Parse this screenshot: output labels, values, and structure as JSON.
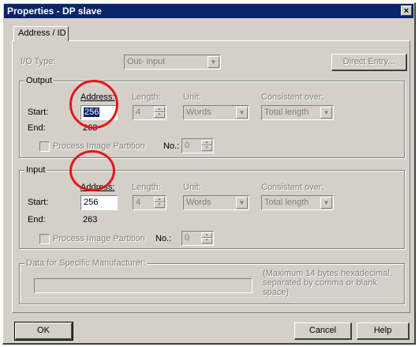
{
  "window": {
    "title": "Properties - DP slave",
    "close_glyph": "×"
  },
  "tab": {
    "label": "Address / ID"
  },
  "io_type": {
    "label": "I/O Type:",
    "value": "Out- input",
    "direct_entry_label": "Direct Entry..."
  },
  "output": {
    "legend": "Output",
    "address_label": "Address:",
    "length_label": "Length:",
    "unit_label": "Unit:",
    "consistent_label": "Consistent over:",
    "start_label": "Start:",
    "end_label": "End:",
    "start_value": "256",
    "length_value": "4",
    "unit_value": "Words",
    "consistent_value": "Total length",
    "end_value": "263",
    "pip_label": "Process Image Partition",
    "no_label": "No.:",
    "no_value": "0"
  },
  "input": {
    "legend": "Input",
    "address_label": "Address:",
    "length_label": "Length:",
    "unit_label": "Unit:",
    "consistent_label": "Consistent over:",
    "start_label": "Start:",
    "end_label": "End:",
    "start_value": "256",
    "length_value": "4",
    "unit_value": "Words",
    "consistent_value": "Total length",
    "end_value": "263",
    "pip_label": "Process Image Partition",
    "no_label": "No.:",
    "no_value": "0"
  },
  "manufacturer": {
    "legend": "Data for Specific Manufacturer:",
    "hint": "(Maximum 14 bytes hexadecimal, separated by comma or blank space)",
    "value": ""
  },
  "buttons": {
    "ok": "OK",
    "cancel": "Cancel",
    "help": "Help"
  },
  "colors": {
    "titlebar": "#0a246a",
    "dialog": "#d4d0c8",
    "annotation_circle": "#e8141c",
    "selection": "#0a246a"
  }
}
